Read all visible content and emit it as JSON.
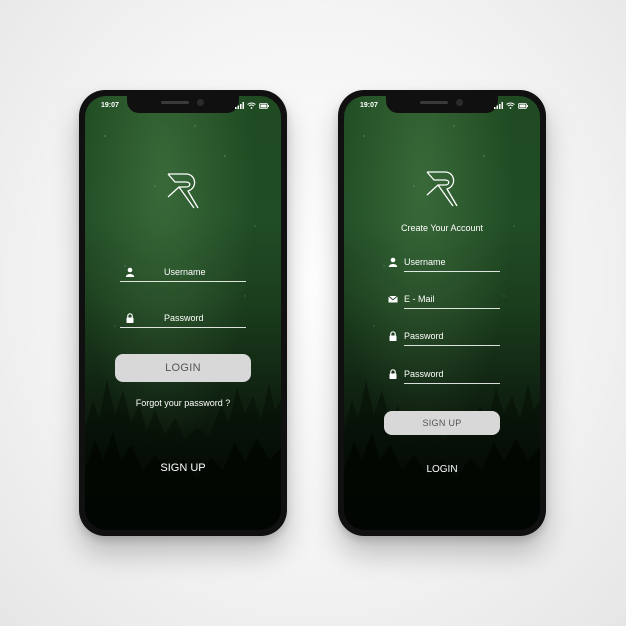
{
  "colors": {
    "screen_green": "#214d25",
    "button_bg": "#d8d8d8",
    "button_text": "#555555",
    "text": "#ffffff"
  },
  "login_screen": {
    "status_time": "19:07",
    "logo_icon": "R-logo-icon",
    "username_label": "Username",
    "password_label": "Password",
    "login_button": "LOGIN",
    "forgot_link": "Forgot your password ?",
    "signup_link": "SIGN UP"
  },
  "signup_screen": {
    "status_time": "19:07",
    "logo_icon": "R-logo-icon",
    "title": "Create Your Account",
    "username_label": "Username",
    "email_label": "E - Mail",
    "password_label": "Password",
    "confirm_password_label": "Password",
    "signup_button": "SIGN UP",
    "login_link": "LOGIN"
  }
}
